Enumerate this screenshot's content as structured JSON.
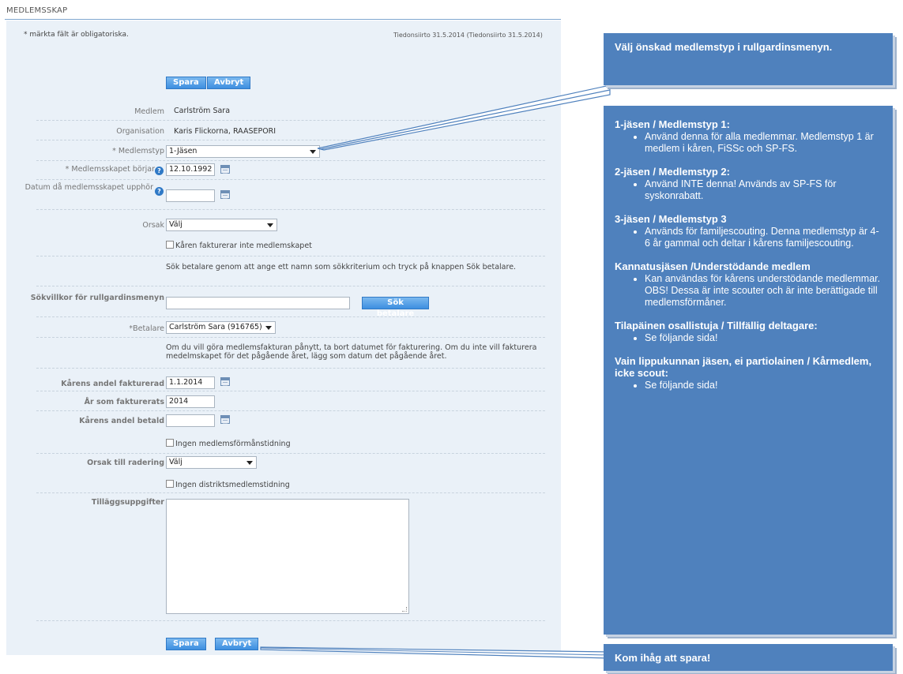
{
  "page": {
    "title": "MEDLEMSSKAP"
  },
  "form": {
    "required_note": "* märkta fält är obligatoriska.",
    "transfer_note": "Tiedonsiirto 31.5.2014 (Tiedonsiirto 31.5.2014)",
    "save_label": "Spara",
    "cancel_label": "Avbryt",
    "fields": {
      "member_label": "Medlem",
      "member_value": "Carlström Sara",
      "organisation_label": "Organisation",
      "organisation_value": "Karis Flickorna, RAASEPORI",
      "membertype_label": "* Medlemstyp",
      "membertype_value": "1-Jäsen",
      "start_label": "* Medlemsskapet börjar",
      "start_value": "12.10.1992",
      "end_label": "Datum då medlemsskapet upphör",
      "end_value": "",
      "reason_label": "Orsak",
      "reason_value": "Välj",
      "no_invoice_label": "Kåren fakturerar inte medlemskapet",
      "search_info": "Sök betalare genom att ange ett namn som sökkriterium och tryck på knappen Sök betalare.",
      "search_label": "Sökvillkor för rullgardinsmenyn",
      "search_value": "",
      "search_button": "Sök betalare",
      "payer_label": "*Betalare",
      "payer_value": "Carlström Sara (916765)",
      "invoice_info": "Om du vill göra medlemsfakturan pånytt, ta bort datumet för fakturering. Om du inte vill fakturera medelmskapet för det pågående året, lägg som datum det pågående året.",
      "invoiced_label": "Kårens andel fakturerad",
      "invoiced_value": "1.1.2014",
      "year_label": "År som fakturerats",
      "year_value": "2014",
      "paid_label": "Kårens andel betald",
      "paid_value": "",
      "no_benefit_mag_label": "Ingen medlemsförmånstidning",
      "delete_reason_label": "Orsak till radering",
      "delete_reason_value": "Välj",
      "no_district_mag_label": "Ingen distriktsmedlemstidning",
      "extra_label": "Tilläggsuppgifter",
      "extra_value": ""
    }
  },
  "callouts": {
    "top": "Välj önskad medlemstyp i rullgardinsmenyn.",
    "bottom": "Kom ihåg att spara!",
    "sections": [
      {
        "head": "1-jäsen / Medlemstyp 1:",
        "items": [
          "Använd denna för alla medlemmar. Medlemstyp 1 är medlem i kåren, FiSSc och SP-FS."
        ]
      },
      {
        "head": "2-jäsen / Medlemstyp 2:",
        "items": [
          "Använd INTE denna! Används av SP-FS för syskonrabatt."
        ]
      },
      {
        "head": "3-jäsen / Medlemstyp 3",
        "items": [
          "Används för familjescouting. Denna medlemstyp är 4-6 år gammal och deltar i kårens familjescouting."
        ]
      },
      {
        "head": "Kannatusjäsen /Understödande medlem",
        "items": [
          "Kan användas för kårens understödande medlemmar. OBS! Dessa är inte scouter och är inte berättigade till medlemsförmåner."
        ]
      },
      {
        "head": "Tilapäinen osallistuja / Tillfällig deltagare:",
        "items": [
          "Se följande sida!"
        ]
      },
      {
        "head": "Vain lippukunnan jäsen, ei partiolainen / Kårmedlem, icke scout:",
        "items": [
          "Se följande sida!"
        ]
      }
    ]
  },
  "icons": {
    "calendar": "calendar-icon",
    "help": "help-icon",
    "dropdown": "chevron-down-icon"
  },
  "colors": {
    "form_bg": "#eaf1f8",
    "button": "#3d8ee0",
    "callout": "#4f81bd",
    "help_icon": "#2f79c6"
  }
}
